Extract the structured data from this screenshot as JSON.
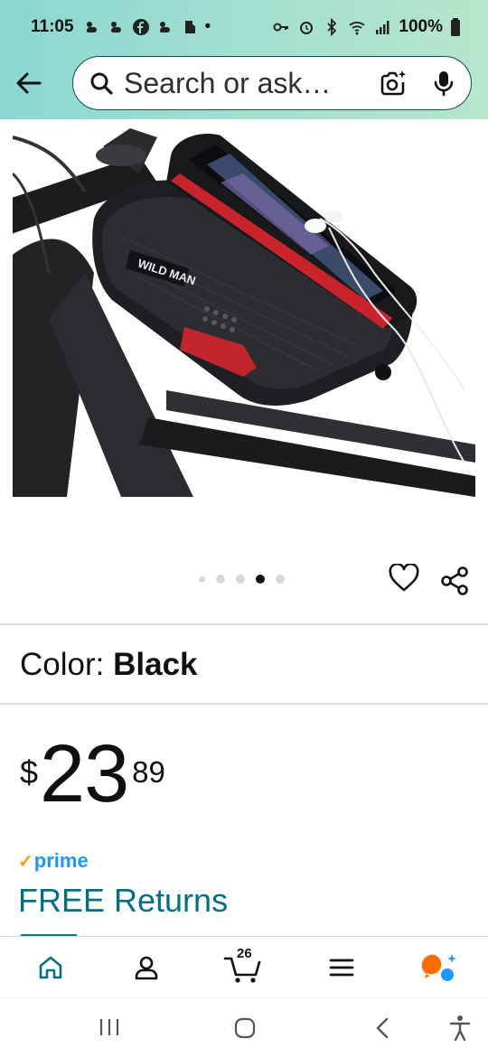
{
  "status_bar": {
    "time": "11:05",
    "battery": "100%",
    "dot": "•"
  },
  "search": {
    "placeholder": "Search or ask…"
  },
  "product": {
    "image_description_icon": "product-photo",
    "carousel_total": 5,
    "carousel_active_index": 3,
    "brand_mark": "WILD MAN"
  },
  "variant": {
    "label": "Color:",
    "value": "Black"
  },
  "price": {
    "symbol": "$",
    "whole": "23",
    "fraction": "89"
  },
  "prime": {
    "check": "✓",
    "label": "prime"
  },
  "returns": {
    "label": "FREE Returns"
  },
  "bottom_nav": {
    "cart_count": "26",
    "items": [
      "home-icon",
      "account-icon",
      "cart-icon",
      "menu-icon",
      "rufus-icon"
    ]
  },
  "colors": {
    "header_start": "#8bd7d2",
    "header_end": "#b7e6cd",
    "link": "#007185",
    "prime_blue": "#1a98ff",
    "prime_check": "#f6a200",
    "active_nav": "#007185",
    "rufus_orange": "#ff6d00",
    "rufus_blue": "#1a98ff"
  }
}
